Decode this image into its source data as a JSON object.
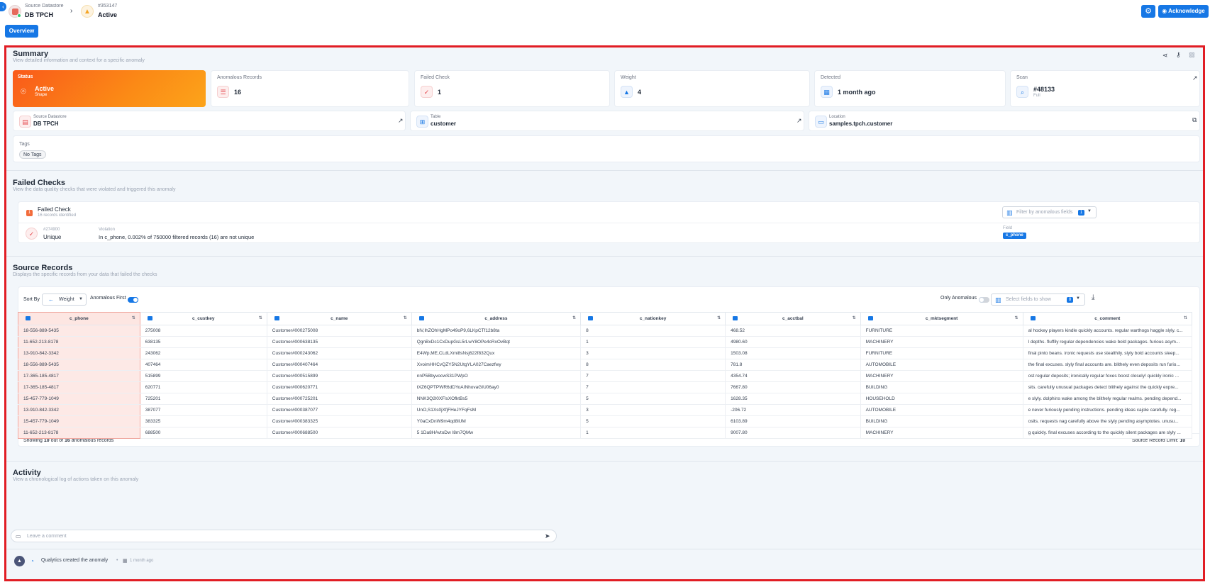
{
  "header": {
    "back_glyph": "‹",
    "datastore_label": "Source Datastore",
    "datastore_name": "DB TPCH",
    "anomaly_id": "#353147",
    "anomaly_status": "Active",
    "overview_tab": "Overview",
    "acknowledge_label": "Acknowledge"
  },
  "summary": {
    "title": "Summary",
    "subtitle": "View detailed information and context for a specific anomaly",
    "status": {
      "label": "Status",
      "value": "Active",
      "sub": "Shape"
    },
    "anomalous_records": {
      "label": "Anomalous Records",
      "value": "16"
    },
    "failed_check": {
      "label": "Failed Check",
      "value": "1"
    },
    "weight": {
      "label": "Weight",
      "value": "4"
    },
    "detected": {
      "label": "Detected",
      "value": "1 month ago"
    },
    "scan": {
      "label": "Scan",
      "value": "#48133",
      "sub": "Full"
    },
    "source_datastore": {
      "label": "Source Datastore",
      "value": "DB TPCH"
    },
    "table": {
      "label": "Table",
      "value": "customer"
    },
    "location": {
      "label": "Location",
      "value": "samples.tpch.customer"
    },
    "tags": {
      "label": "Tags",
      "chip": "No Tags"
    }
  },
  "failed_checks": {
    "title": "Failed Checks",
    "subtitle": "View the data quality checks that were violated and triggered this anomaly",
    "card_title": "Failed Check",
    "badge": "1",
    "records_identified": "16 records identified",
    "filter_placeholder": "Filter by anomalous fields",
    "filter_count": "1",
    "check_id": "#274900",
    "check_type": "Unique",
    "violation_label": "Violation",
    "violation_text": "In c_phone, 0.002% of 750000 filtered records (16) are not unique",
    "field_label": "Field",
    "field_value": "c_phone"
  },
  "source_records": {
    "title": "Source Records",
    "subtitle": "Displays the specific records from your data that failed the checks",
    "sort_by_label": "Sort By",
    "sort_value": "Weight",
    "anomalous_first_label": "Anomalous First",
    "only_anomalous_label": "Only Anomalous",
    "select_fields_placeholder": "Select fields to show",
    "select_fields_count": "8",
    "columns": [
      "c_phone",
      "c_custkey",
      "c_name",
      "c_address",
      "c_nationkey",
      "c_acctbal",
      "c_mktsegment",
      "c_comment"
    ],
    "rows": [
      [
        "18-556-889-5435",
        "275008",
        "Customer#000275008",
        "blV,IhZOhHgMPo49oP9,6LKpCTf12b8ta",
        "8",
        "468.52",
        "FURNITURE",
        "al hockey players kindle quickly accounts. regular warthogs haggle slyly. c..."
      ],
      [
        "11-652-213-8178",
        "638135",
        "Customer#000638135",
        "QgnBxDc1CxDupGsL5rLwY8OPe4cRxOvBqt",
        "1",
        "4980.60",
        "MACHINERY",
        "l depths. fluffily regular dependencies wake bold packages. furious asym..."
      ],
      [
        "13-910-842-3342",
        "243062",
        "Customer#000243062",
        "E4Wp,ME,CLdLXmi8sNsj622f832Qux",
        "3",
        "1503.08",
        "FURNITURE",
        "final pinto beans. ironic requests use stealthily. slyly bold accounts sleep..."
      ],
      [
        "18-556-889-5435",
        "407464",
        "Customer#000407464",
        "XvoimHHCvQZY5N2UtgYLA027Caezfwy",
        "8",
        "781.8",
        "AUTOMOBILE",
        "the final excuses. slyly final accounts are. blithely even deposits run furio..."
      ],
      [
        "17-365-185-4817",
        "515899",
        "Customer#000515899",
        "nnP5BbyvocwS31PWpO",
        "7",
        "4354.74",
        "MACHINERY",
        "ost regular deposits; ironically regular foxes boost closely! quickly ironic ..."
      ],
      [
        "17-365-185-4817",
        "620771",
        "Customer#000620771",
        "tXZ6QPTPWR6dDYoAINhovaGIU06ay0",
        "7",
        "7667.80",
        "BUILDING",
        "sits. carefully unusual packages detect blithely against the quickly expre..."
      ],
      [
        "15-457-779-1049",
        "725201",
        "Customer#000725201",
        "NNK3Q2l0XFlsXOfktBs5",
        "5",
        "1628.35",
        "HOUSEHOLD",
        "e slyly. dolphins wake among the blithely regular realms. pending depend..."
      ],
      [
        "13-910-842-3342",
        "387077",
        "Customer#000387077",
        "UnO,S1Xs0jXfjFHeJYFqFsM",
        "3",
        "-206.72",
        "AUTOMOBILE",
        "e never furiously pending instructions. pending ideas cajole carefully. reg..."
      ],
      [
        "15-457-779-1049",
        "383325",
        "Customer#000383325",
        "Y0aCxDnW9m4qd8lUM",
        "5",
        "6103.89",
        "BUILDING",
        "osits. requests nag carefully above the slyly pending asymptotes. unusu..."
      ],
      [
        "11-652-213-8178",
        "688500",
        "Customer#000688500",
        "5 1Da8HAvtoDw I8m7QMw",
        "1",
        "9007.80",
        "MACHINERY",
        "g quickly. final excuses according to the quickly silent packages are slyly ..."
      ]
    ],
    "footer_showing": "Showing",
    "footer_shown": "10",
    "footer_outof": "out of",
    "footer_total": "16",
    "footer_suffix": "anomalous records",
    "record_limit_label": "Source Record Limit:",
    "record_limit_value": "10"
  },
  "activity": {
    "title": "Activity",
    "subtitle": "View a chronological log of actions taken on this anomaly",
    "comment_placeholder": "Leave a comment",
    "log_actor": "Qualytics created the anomaly",
    "log_time": "1 month ago"
  },
  "colors": {
    "accent": "#1677e5",
    "frame": "#e11d24",
    "status_gradient_start": "#fa5a1a",
    "status_gradient_end": "#fca41a"
  }
}
